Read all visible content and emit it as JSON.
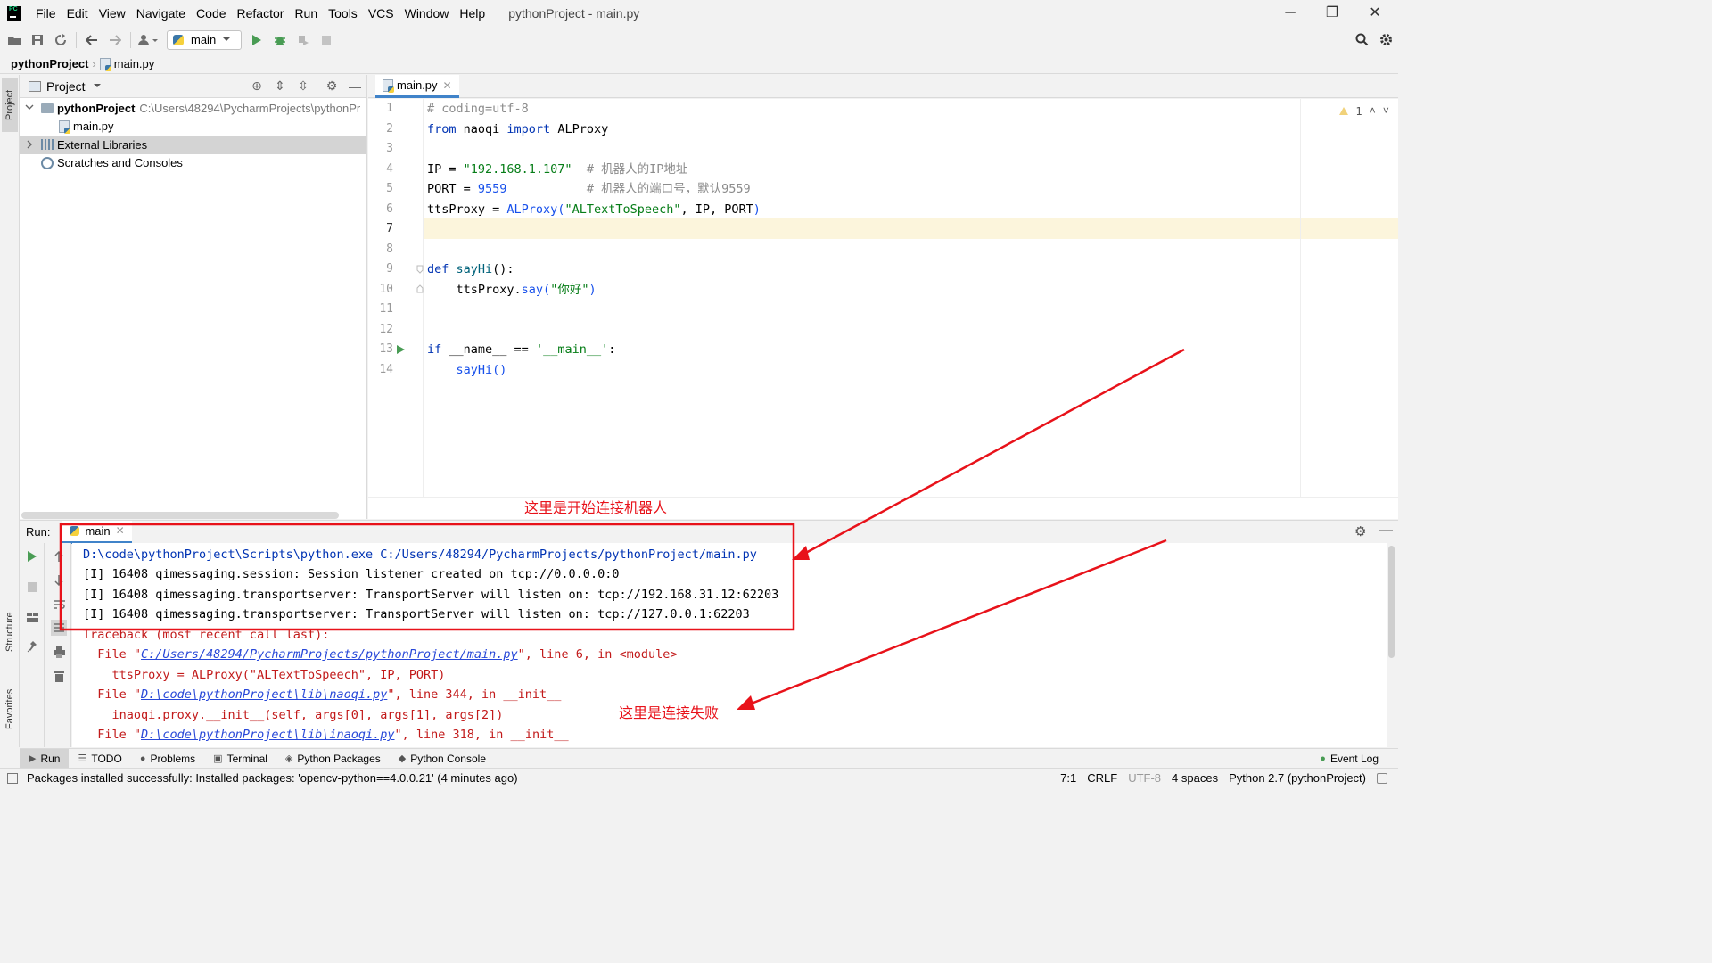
{
  "menubar": {
    "items": [
      "File",
      "Edit",
      "View",
      "Navigate",
      "Code",
      "Refactor",
      "Run",
      "Tools",
      "VCS",
      "Window",
      "Help"
    ],
    "window_title": "pythonProject - main.py",
    "minimize": "─",
    "restore": "❐",
    "close": "✕"
  },
  "toolbar": {
    "run_config": "main"
  },
  "breadcrumb": {
    "project": "pythonProject",
    "file": "main.py"
  },
  "left_strip": {
    "project_tab": "Project",
    "structure_tab": "Structure",
    "favorites_tab": "Favorites"
  },
  "project_panel": {
    "title": "Project",
    "tree": [
      {
        "label": "pythonProject",
        "path": "C:\\Users\\48294\\PycharmProjects\\pythonPr"
      },
      {
        "label": "main.py"
      },
      {
        "label": "External Libraries"
      },
      {
        "label": "Scratches and Consoles"
      }
    ]
  },
  "editor": {
    "tab_label": "main.py",
    "warning_count": "1",
    "line_numbers": [
      "1",
      "2",
      "3",
      "4",
      "5",
      "6",
      "7",
      "8",
      "9",
      "10",
      "11",
      "12",
      "13",
      "14"
    ],
    "lines": {
      "l1": "# coding=utf-8",
      "l2_kw1": "from",
      "l2_mod": " naoqi ",
      "l2_kw2": "import",
      "l2_name": " ALProxy",
      "l4_a": "IP = ",
      "l4_str": "\"192.168.1.107\"",
      "l4_com": "  # 机器人的IP地址",
      "l5_a": "PORT = ",
      "l5_num": "9559",
      "l5_com": "           # 机器人的端口号，默认9559",
      "l6_a": "ttsProxy = ",
      "l6_call": "ALProxy(",
      "l6_str": "\"ALTextToSpeech\"",
      "l6_b": ", IP, PORT",
      "l6_close": ")",
      "l9_kw": "def ",
      "l9_fn": "sayHi",
      "l9_b": "():",
      "l10_a": "    ttsProxy.",
      "l10_call": "say(",
      "l10_str": "\"你好\"",
      "l10_close": ")",
      "l13_kw": "if ",
      "l13_a": "__name__ == ",
      "l13_str": "'__main__'",
      "l13_b": ":",
      "l14_a": "    ",
      "l14_call": "sayHi()"
    }
  },
  "run_panel": {
    "label": "Run:",
    "tab": "main",
    "console": {
      "c1": "D:\\code\\pythonProject\\Scripts\\python.exe C:/Users/48294/PycharmProjects/pythonProject/main.py",
      "c2": "[I] 16408 qimessaging.session: Session listener created on tcp://0.0.0.0:0",
      "c3": "[I] 16408 qimessaging.transportserver: TransportServer will listen on: tcp://192.168.31.12:62203",
      "c4": "[I] 16408 qimessaging.transportserver: TransportServer will listen on: tcp://127.0.0.1:62203",
      "c5": "Traceback (most recent call last):",
      "c6_a": "  File \"",
      "c6_link": "C:/Users/48294/PycharmProjects/pythonProject/main.py",
      "c6_b": "\", line 6, in <module>",
      "c7": "    ttsProxy = ALProxy(\"ALTextToSpeech\", IP, PORT)",
      "c8_a": "  File \"",
      "c8_link": "D:\\code\\pythonProject\\lib\\naoqi.py",
      "c8_b": "\", line 344, in __init__",
      "c9": "    inaoqi.proxy.__init__(self, args[0], args[1], args[2])",
      "c10_a": "  File \"",
      "c10_link": "D:\\code\\pythonProject\\lib\\inaoqi.py",
      "c10_b": "\", line 318, in __init__"
    }
  },
  "tool_tabs": [
    "Run",
    "TODO",
    "Problems",
    "Terminal",
    "Python Packages",
    "Python Console"
  ],
  "event_log": "Event Log",
  "statusbar": {
    "message": "Packages installed successfully: Installed packages: 'opencv-python==4.0.0.21' (4 minutes ago)",
    "position": "7:1",
    "line_sep": "CRLF",
    "encoding": "UTF-8",
    "indent": "4 spaces",
    "interpreter": "Python 2.7 (pythonProject)"
  },
  "annotations": {
    "start_text": "这里是开始连接机器人",
    "fail_text": "这里是连接失败",
    "color": "#e8121a"
  }
}
